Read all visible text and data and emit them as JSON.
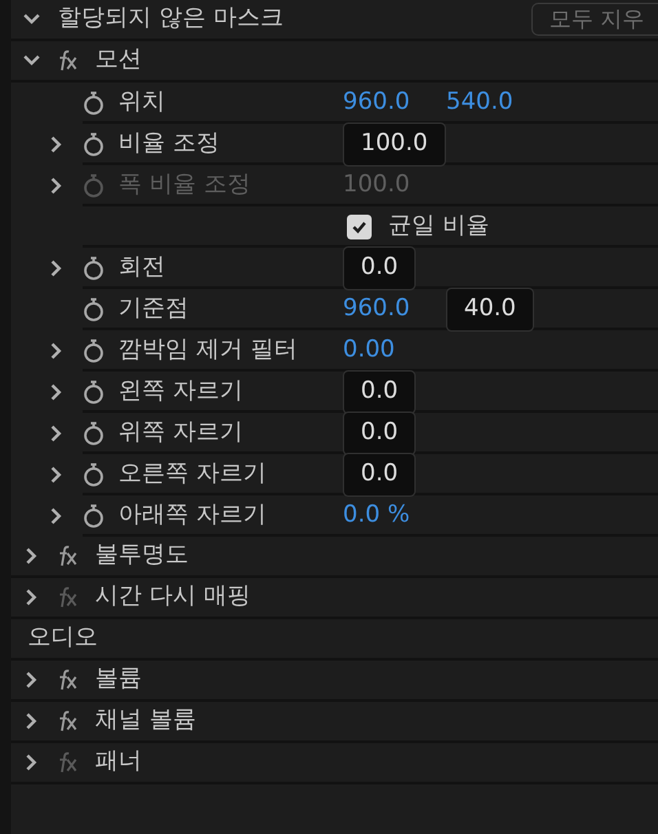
{
  "mask": {
    "label": "할당되지 않은 마스크",
    "expanded": true,
    "button": "모두 지우"
  },
  "effects": [
    {
      "name": "모션",
      "fx_on": true,
      "expanded": true,
      "properties": [
        {
          "kind": "param",
          "label": "위치",
          "expandable": false,
          "disabled": false,
          "values": [
            {
              "kind": "link",
              "text": "960.0"
            },
            {
              "kind": "link",
              "text": "540.0"
            }
          ]
        },
        {
          "kind": "param",
          "label": "비율 조정",
          "expandable": true,
          "disabled": false,
          "values": [
            {
              "kind": "field",
              "text": "100.0"
            }
          ]
        },
        {
          "kind": "param",
          "label": "폭 비율 조정",
          "expandable": true,
          "disabled": true,
          "values": [
            {
              "kind": "plain",
              "text": "100.0"
            }
          ]
        },
        {
          "kind": "checkbox",
          "label": "균일 비율",
          "checked": true
        },
        {
          "kind": "param",
          "label": "회전",
          "expandable": true,
          "disabled": false,
          "values": [
            {
              "kind": "field",
              "text": "0.0"
            }
          ]
        },
        {
          "kind": "param",
          "label": "기준점",
          "expandable": false,
          "disabled": false,
          "values": [
            {
              "kind": "link",
              "text": "960.0"
            },
            {
              "kind": "field",
              "text": "40.0"
            }
          ]
        },
        {
          "kind": "param",
          "label": "깜박임 제거 필터",
          "expandable": true,
          "disabled": false,
          "values": [
            {
              "kind": "link",
              "text": "0.00"
            }
          ]
        },
        {
          "kind": "param",
          "label": "왼쪽 자르기",
          "expandable": true,
          "disabled": false,
          "values": [
            {
              "kind": "field",
              "text": "0.0"
            }
          ]
        },
        {
          "kind": "param",
          "label": "위쪽 자르기",
          "expandable": true,
          "disabled": false,
          "values": [
            {
              "kind": "field",
              "text": "0.0"
            }
          ]
        },
        {
          "kind": "param",
          "label": "오른쪽 자르기",
          "expandable": true,
          "disabled": false,
          "values": [
            {
              "kind": "field",
              "text": "0.0"
            }
          ]
        },
        {
          "kind": "param",
          "label": "아래쪽 자르기",
          "expandable": true,
          "disabled": false,
          "values": [
            {
              "kind": "link",
              "text": "0.0 %"
            }
          ]
        }
      ]
    },
    {
      "name": "불투명도",
      "fx_on": true,
      "expanded": false
    },
    {
      "name": "시간 다시 매핑",
      "fx_on": false,
      "expanded": false
    }
  ],
  "audio": {
    "label": "오디오",
    "effects": [
      {
        "name": "볼륨",
        "fx_on": true,
        "expanded": false
      },
      {
        "name": "채널 볼륨",
        "fx_on": true,
        "expanded": false
      },
      {
        "name": "패너",
        "fx_on": false,
        "expanded": false
      }
    ]
  }
}
